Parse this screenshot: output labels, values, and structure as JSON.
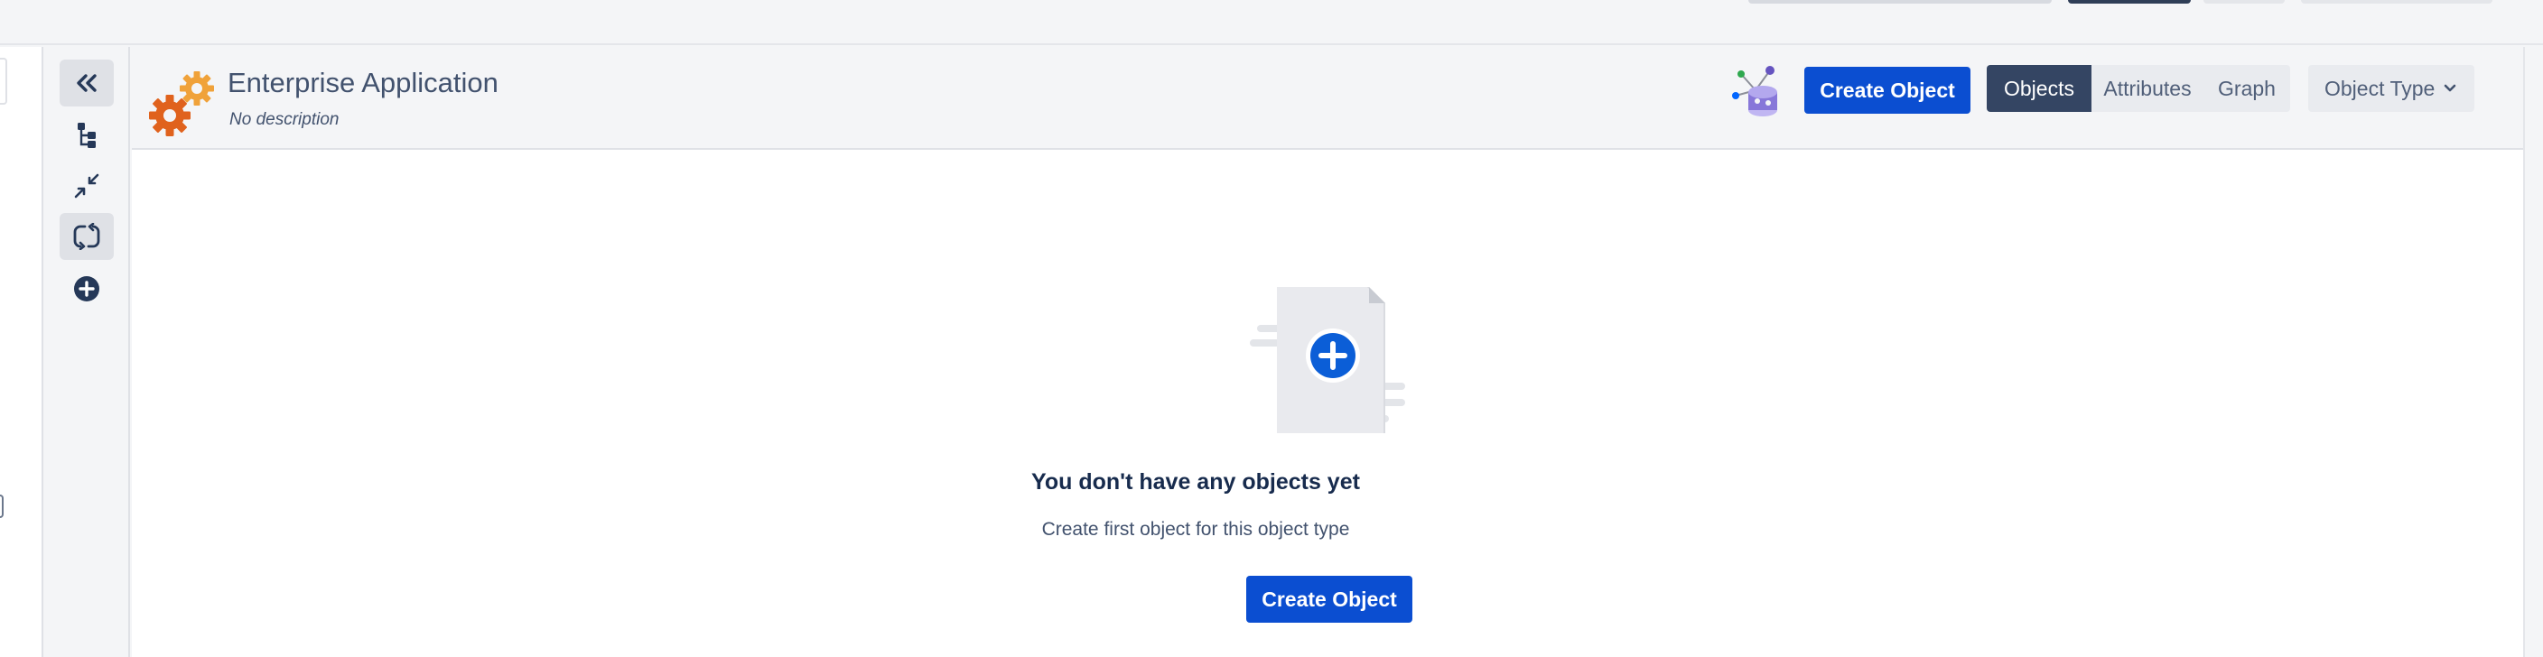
{
  "header": {
    "title": "Enterprise Application",
    "description": "No description",
    "create_label": "Create Object"
  },
  "view_tabs": [
    {
      "label": "Objects",
      "active": true
    },
    {
      "label": "Attributes",
      "active": false
    },
    {
      "label": "Graph",
      "active": false
    }
  ],
  "object_type_dropdown": {
    "label": "Object Type"
  },
  "rail": {
    "items": [
      "collapse-icon",
      "tree-icon",
      "compress-icon",
      "refresh-icon",
      "add-circle-icon"
    ]
  },
  "empty_state": {
    "title": "You don't have any objects yet",
    "subtitle": "Create first object for this object type",
    "button_label": "Create Object"
  },
  "colors": {
    "primary": "#0b4ed1",
    "active_tab": "#344563",
    "gear_orange": "#e0621d",
    "gear_light": "#f0a23a"
  }
}
